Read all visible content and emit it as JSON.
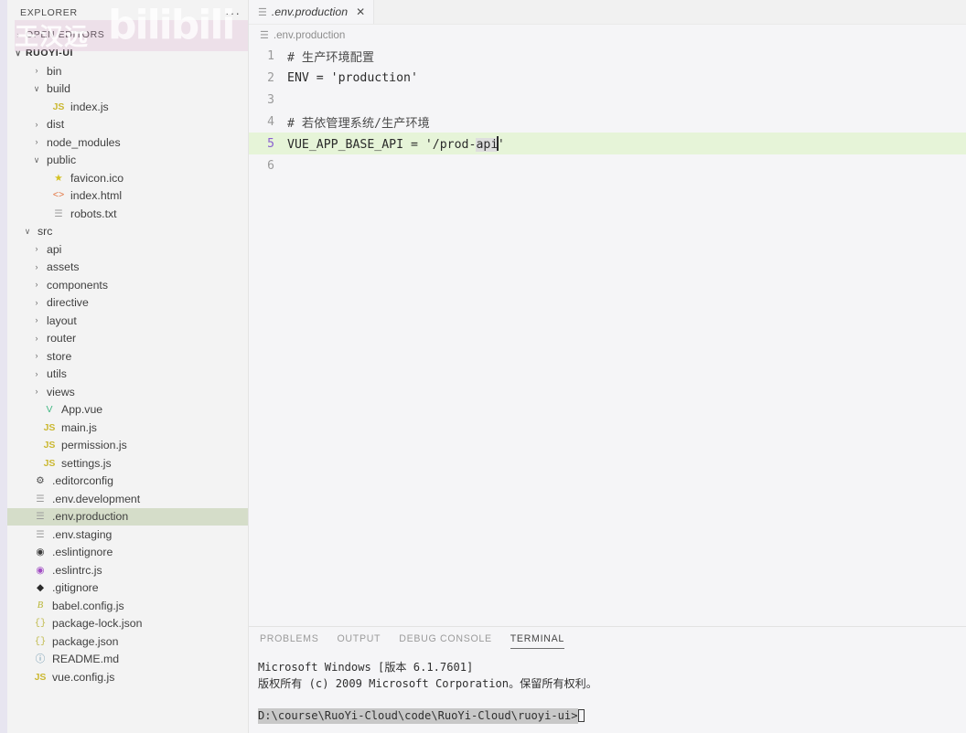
{
  "activity_bar": {
    "name": "activity-bar"
  },
  "sidebar": {
    "title": "EXPLORER",
    "more_icon": "···",
    "watermark": {
      "brand": "bilibili",
      "text_cn": "王汉远"
    },
    "sections": [
      {
        "label": "OPEN EDITORS",
        "expanded": false,
        "chevron": "›"
      },
      {
        "label": "RUOYI-UI",
        "expanded": true,
        "chevron": "∨"
      }
    ],
    "tree": [
      {
        "label": "bin",
        "type": "folder",
        "indent": 2,
        "chevron": "›",
        "icon": "",
        "icon_class": ""
      },
      {
        "label": "build",
        "type": "folder",
        "indent": 2,
        "chevron": "∨",
        "icon": "",
        "icon_class": ""
      },
      {
        "label": "index.js",
        "type": "file",
        "indent": 3,
        "chevron": "",
        "icon": "JS",
        "icon_class": "ic-js"
      },
      {
        "label": "dist",
        "type": "folder",
        "indent": 2,
        "chevron": "›",
        "icon": "",
        "icon_class": ""
      },
      {
        "label": "node_modules",
        "type": "folder",
        "indent": 2,
        "chevron": "›",
        "icon": "",
        "icon_class": ""
      },
      {
        "label": "public",
        "type": "folder",
        "indent": 2,
        "chevron": "∨",
        "icon": "",
        "icon_class": ""
      },
      {
        "label": "favicon.ico",
        "type": "file",
        "indent": 3,
        "chevron": "",
        "icon": "★",
        "icon_class": "ic-star"
      },
      {
        "label": "index.html",
        "type": "file",
        "indent": 3,
        "chevron": "",
        "icon": "<>",
        "icon_class": "ic-html"
      },
      {
        "label": "robots.txt",
        "type": "file",
        "indent": 3,
        "chevron": "",
        "icon": "☰",
        "icon_class": "ic-txt"
      },
      {
        "label": "src",
        "type": "folder",
        "indent": 1,
        "chevron": "∨",
        "icon": "",
        "icon_class": ""
      },
      {
        "label": "api",
        "type": "folder",
        "indent": 2,
        "chevron": "›",
        "icon": "",
        "icon_class": ""
      },
      {
        "label": "assets",
        "type": "folder",
        "indent": 2,
        "chevron": "›",
        "icon": "",
        "icon_class": ""
      },
      {
        "label": "components",
        "type": "folder",
        "indent": 2,
        "chevron": "›",
        "icon": "",
        "icon_class": ""
      },
      {
        "label": "directive",
        "type": "folder",
        "indent": 2,
        "chevron": "›",
        "icon": "",
        "icon_class": ""
      },
      {
        "label": "layout",
        "type": "folder",
        "indent": 2,
        "chevron": "›",
        "icon": "",
        "icon_class": ""
      },
      {
        "label": "router",
        "type": "folder",
        "indent": 2,
        "chevron": "›",
        "icon": "",
        "icon_class": ""
      },
      {
        "label": "store",
        "type": "folder",
        "indent": 2,
        "chevron": "›",
        "icon": "",
        "icon_class": ""
      },
      {
        "label": "utils",
        "type": "folder",
        "indent": 2,
        "chevron": "›",
        "icon": "",
        "icon_class": ""
      },
      {
        "label": "views",
        "type": "folder",
        "indent": 2,
        "chevron": "›",
        "icon": "",
        "icon_class": ""
      },
      {
        "label": "App.vue",
        "type": "file",
        "indent": 2,
        "chevron": "",
        "icon": "V",
        "icon_class": "ic-vue"
      },
      {
        "label": "main.js",
        "type": "file",
        "indent": 2,
        "chevron": "",
        "icon": "JS",
        "icon_class": "ic-js"
      },
      {
        "label": "permission.js",
        "type": "file",
        "indent": 2,
        "chevron": "",
        "icon": "JS",
        "icon_class": "ic-js"
      },
      {
        "label": "settings.js",
        "type": "file",
        "indent": 2,
        "chevron": "",
        "icon": "JS",
        "icon_class": "ic-js"
      },
      {
        "label": ".editorconfig",
        "type": "file",
        "indent": 1,
        "chevron": "",
        "icon": "⚙",
        "icon_class": "ic-gear"
      },
      {
        "label": ".env.development",
        "type": "file",
        "indent": 1,
        "chevron": "",
        "icon": "☰",
        "icon_class": "ic-txt"
      },
      {
        "label": ".env.production",
        "type": "file",
        "indent": 1,
        "chevron": "",
        "icon": "☰",
        "icon_class": "ic-txt",
        "selected": true
      },
      {
        "label": ".env.staging",
        "type": "file",
        "indent": 1,
        "chevron": "",
        "icon": "☰",
        "icon_class": "ic-txt"
      },
      {
        "label": ".eslintignore",
        "type": "file",
        "indent": 1,
        "chevron": "",
        "icon": "◉",
        "icon_class": "ic-eye"
      },
      {
        "label": ".eslintrc.js",
        "type": "file",
        "indent": 1,
        "chevron": "",
        "icon": "◉",
        "icon_class": "ic-eye2"
      },
      {
        "label": ".gitignore",
        "type": "file",
        "indent": 1,
        "chevron": "",
        "icon": "◆",
        "icon_class": "ic-git"
      },
      {
        "label": "babel.config.js",
        "type": "file",
        "indent": 1,
        "chevron": "",
        "icon": "B",
        "icon_class": "ic-bab"
      },
      {
        "label": "package-lock.json",
        "type": "file",
        "indent": 1,
        "chevron": "",
        "icon": "{}",
        "icon_class": "ic-json"
      },
      {
        "label": "package.json",
        "type": "file",
        "indent": 1,
        "chevron": "",
        "icon": "{}",
        "icon_class": "ic-json"
      },
      {
        "label": "README.md",
        "type": "file",
        "indent": 1,
        "chevron": "",
        "icon": "ⓘ",
        "icon_class": "ic-md"
      },
      {
        "label": "vue.config.js",
        "type": "file",
        "indent": 1,
        "chevron": "",
        "icon": "JS",
        "icon_class": "ic-js"
      }
    ]
  },
  "editor": {
    "tab": {
      "label": ".env.production",
      "icon": "☰",
      "close_icon": "✕",
      "preview": true
    },
    "breadcrumb": {
      "label": ".env.production",
      "icon": "☰"
    },
    "lines": [
      {
        "no": "1",
        "segments": [
          {
            "text": "# 生产环境配置",
            "style": "comment"
          }
        ]
      },
      {
        "no": "2",
        "segments": [
          {
            "text": "ENV = 'production'",
            "style": "plain"
          }
        ]
      },
      {
        "no": "3",
        "segments": [
          {
            "text": "",
            "style": "plain"
          }
        ]
      },
      {
        "no": "4",
        "segments": [
          {
            "text": "# 若依管理系统/生产环境",
            "style": "comment"
          }
        ]
      },
      {
        "no": "5",
        "active": true,
        "segments": [
          {
            "text": "VUE_APP_BASE_API = '/prod-",
            "style": "plain"
          },
          {
            "text": "api",
            "style": "wordhl"
          },
          {
            "text": "",
            "style": "caret"
          },
          {
            "text": "'",
            "style": "plain"
          }
        ]
      },
      {
        "no": "6",
        "segments": [
          {
            "text": "",
            "style": "plain"
          }
        ]
      }
    ]
  },
  "panel": {
    "tabs": [
      {
        "label": "PROBLEMS",
        "active": false
      },
      {
        "label": "OUTPUT",
        "active": false
      },
      {
        "label": "DEBUG CONSOLE",
        "active": false
      },
      {
        "label": "TERMINAL",
        "active": true
      }
    ],
    "terminal": {
      "lines": [
        "Microsoft Windows [版本 6.1.7601]",
        "版权所有 (c) 2009 Microsoft Corporation。保留所有权利。",
        ""
      ],
      "prompt": "D:\\course\\RuoYi-Cloud\\code\\RuoYi-Cloud\\ruoyi-ui>"
    }
  },
  "colors": {
    "editor_bg": "#f5f5f7",
    "sidebar_bg": "#f3f3f3",
    "active_line": "#e6f4d8",
    "selected_row": "#d5ddc9",
    "activity_bar": "#e7e5f0",
    "line_number_active": "#8a5fd0"
  }
}
